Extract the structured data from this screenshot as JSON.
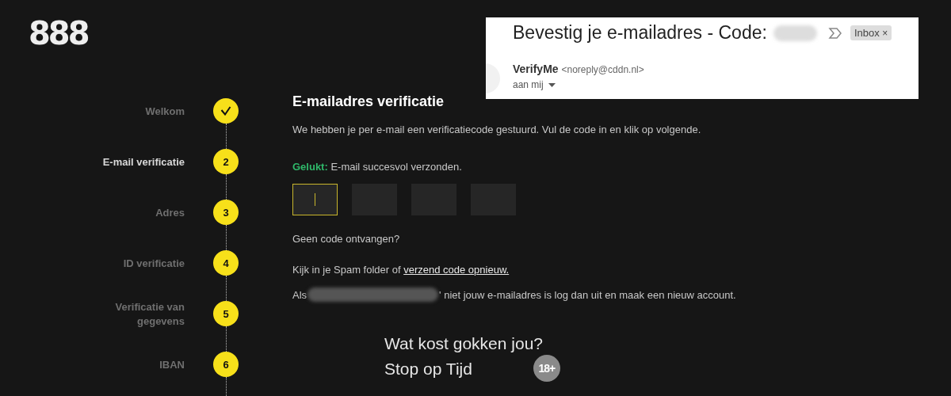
{
  "logo": "888",
  "steps": [
    {
      "label": "Welkom",
      "done": true,
      "selected": false
    },
    {
      "label": "E-mail verificatie",
      "number": "2",
      "done": false,
      "selected": true
    },
    {
      "label": "Adres",
      "number": "3",
      "done": false,
      "selected": false
    },
    {
      "label": "ID verificatie",
      "number": "4",
      "done": false,
      "selected": false
    },
    {
      "label": "Verificatie van gegevens",
      "number": "5",
      "done": false,
      "selected": false
    },
    {
      "label": "IBAN",
      "number": "6",
      "done": false,
      "selected": false
    }
  ],
  "form": {
    "title": "E-mailadres verificatie",
    "intro": "We hebben je per e-mail een verificatiecode gestuurd. Vul de code in en klik op volgende.",
    "success_label": "Gelukt:",
    "success_text": "E-mail succesvol verzonden.",
    "code_boxes": [
      {
        "focused": true
      },
      {
        "focused": false
      },
      {
        "focused": false
      },
      {
        "focused": false
      }
    ],
    "no_code": "Geen code ontvangen?",
    "spam_text": "Kijk in je Spam folder of",
    "resend_link": "verzend code opnieuw.",
    "logout_prefix": "Als",
    "logout_suffix": "' niet jouw e-mailadres is log dan uit en maak een nieuw account."
  },
  "email": {
    "subject": "Bevestig je e-mailadres - Code:",
    "label": "Inbox",
    "label_close": "×",
    "sender": "VerifyMe",
    "address": "<noreply@cddn.nl>",
    "recipient": "aan mij"
  },
  "footer": {
    "line_1": "Wat kost gokken jou?",
    "line_2": "Stop op Tijd",
    "age_badge": "18+"
  }
}
